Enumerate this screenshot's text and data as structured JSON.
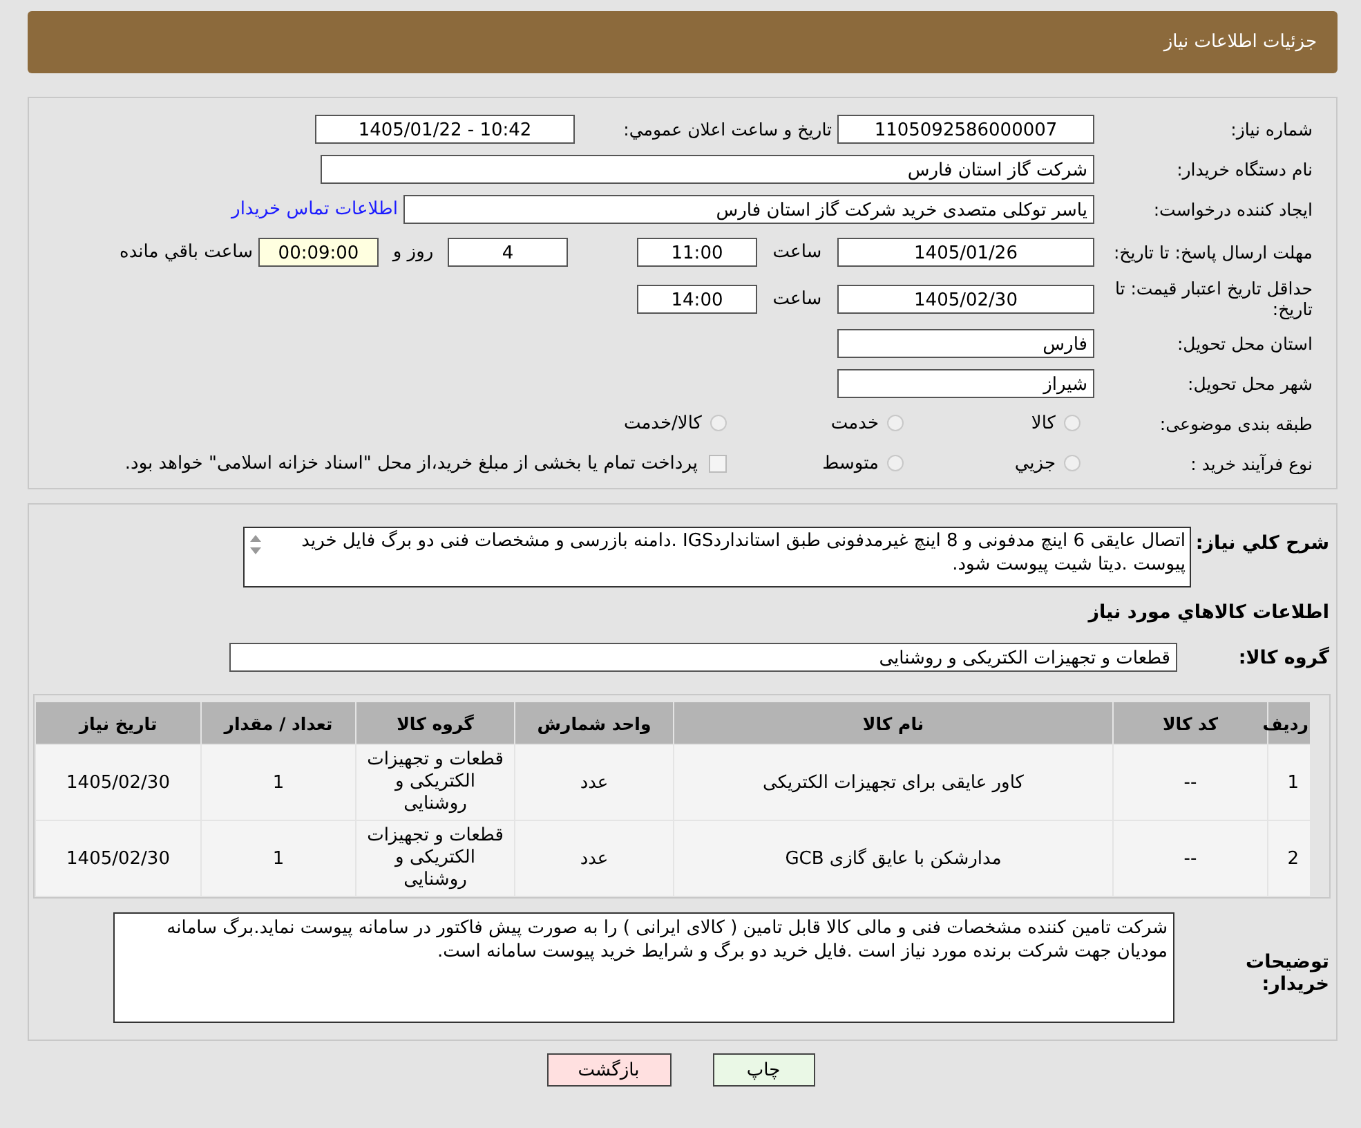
{
  "header": {
    "title": "جزئیات اطلاعات نیاز"
  },
  "fields": {
    "need_number": {
      "label": "شماره نیاز:",
      "value": "1105092586000007"
    },
    "announce": {
      "label": "تاریخ و ساعت اعلان عمومي:",
      "value": "1405/01/22 - 10:42"
    },
    "buyer": {
      "label": "نام دستگاه خریدار:",
      "value": "شرکت گاز استان فارس"
    },
    "creator": {
      "label": "ایجاد کننده درخواست:",
      "value": "یاسر توکلی متصدی خرید شرکت گاز استان فارس",
      "link": "اطلاعات تماس خریدار"
    },
    "deadline": {
      "label": "مهلت ارسال پاسخ: تا تاریخ:",
      "date": "1405/01/26",
      "time_label": "ساعت",
      "time": "11:00",
      "days": "4",
      "days_label": "روز و",
      "remaining": "00:09:00",
      "remaining_label": "ساعت باقي مانده"
    },
    "validity": {
      "label": "حداقل تاریخ اعتبار قیمت: تا تاریخ:",
      "date": "1405/02/30",
      "time_label": "ساعت",
      "time": "14:00"
    },
    "province": {
      "label": "استان محل تحویل:",
      "value": "فارس"
    },
    "city": {
      "label": "شهر محل تحویل:",
      "value": "شیراز"
    }
  },
  "category": {
    "label": "طبقه بندی موضوعی:",
    "options": [
      {
        "label": "کالا",
        "selected": false
      },
      {
        "label": "خدمت",
        "selected": false
      },
      {
        "label": "کالا/خدمت",
        "selected": false
      }
    ]
  },
  "process": {
    "label": "نوع فرآیند خرید :",
    "options": [
      {
        "label": "جزیي",
        "selected": false
      },
      {
        "label": "متوسط",
        "selected": false
      }
    ],
    "payment": {
      "checked": false,
      "text": "پرداخت تمام یا بخشی از مبلغ خرید،از محل \"اسناد خزانه اسلامی\" خواهد بود."
    }
  },
  "description": {
    "label": "شرح کلي نیاز:",
    "value": "اتصال عایقی 6 اینچ مدفونی و 8 اینچ غیرمدفونی طبق استانداردIGS .دامنه بازرسی و مشخصات فنی دو برگ فایل خرید پیوست .دیتا شیت پیوست شود."
  },
  "goods_heading": "اطلاعات کالاهاي مورد نیاز",
  "goods_group": {
    "label": "گروه کالا:",
    "value": "قطعات و تجهیزات الکتریکی و روشنایی"
  },
  "table": {
    "columns": [
      "ردیف",
      "کد کالا",
      "نام کالا",
      "واحد شمارش",
      "گروه کالا",
      "تعداد / مقدار",
      "تاریخ نیاز"
    ],
    "rows": [
      [
        "1",
        "--",
        "کاور عایقی برای تجهیزات الکتریکی",
        "عدد",
        "قطعات و تجهیزات الکتریکی و روشنایی",
        "1",
        "1405/02/30"
      ],
      [
        "2",
        "--",
        "مدارشکن با عایق گازی GCB",
        "عدد",
        "قطعات و تجهیزات الکتریکی و روشنایی",
        "1",
        "1405/02/30"
      ]
    ]
  },
  "notes": {
    "label": "توضیحات خریدار:",
    "value": "شرکت تامین کننده مشخصات فنی و مالی کالا قابل تامین ( کالای ایرانی ) را به صورت پیش فاکتور در سامانه پیوست نماید.برگ سامانه مودیان جهت شرکت برنده مورد نیاز است .فایل خرید دو برگ و شرایط خرید پیوست سامانه است."
  },
  "buttons": [
    {
      "kind": "print",
      "label": "چاپ"
    },
    {
      "kind": "back",
      "label": "بازگشت"
    }
  ]
}
